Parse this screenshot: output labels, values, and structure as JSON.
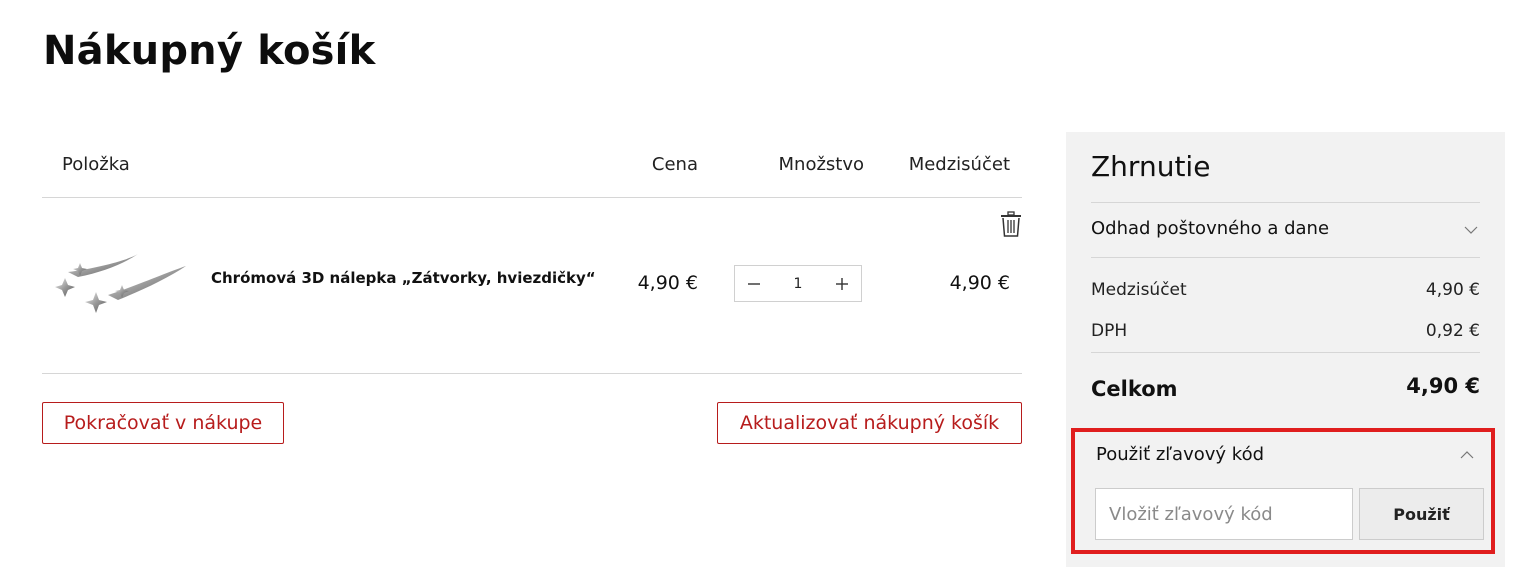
{
  "page": {
    "title": "Nákupný košík"
  },
  "cart": {
    "headers": {
      "item": "Položka",
      "price": "Cena",
      "quantity": "Množstvo",
      "subtotal": "Medzisúčet"
    },
    "items": [
      {
        "name": "Chrómová 3D nálepka „Zátvorky, hviezdičky“",
        "price": "4,90 €",
        "quantity": "1",
        "subtotal": "4,90 €"
      }
    ],
    "continue_label": "Pokračovať v nákupe",
    "update_label": "Aktualizovať nákupný košík"
  },
  "summary": {
    "title": "Zhrnutie",
    "shipping_label": "Odhad poštovného a dane",
    "rows": [
      {
        "label": "Medzisúčet",
        "value": "4,90 €"
      },
      {
        "label": "DPH",
        "value": "0,92 €"
      }
    ],
    "total_label": "Celkom",
    "total_value": "4,90 €",
    "discount": {
      "label": "Použiť zľavový kód",
      "placeholder": "Vložiť zľavový kód",
      "value": "",
      "apply_label": "Použiť"
    }
  },
  "colors": {
    "accent": "#b71c1c",
    "highlight": "#e01e1e",
    "summary_bg": "#f2f2f2"
  },
  "icons": [
    "trash-icon",
    "minus-icon",
    "plus-icon",
    "chevron-down-icon",
    "chevron-up-icon"
  ]
}
